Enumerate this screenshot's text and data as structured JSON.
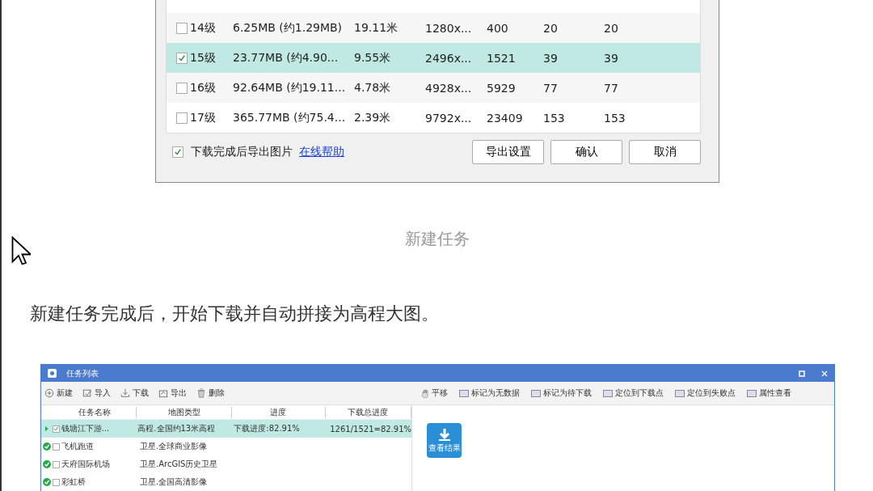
{
  "level_dialog": {
    "rows": [
      {
        "level": "14级",
        "size": "6.25MB (约1.29MB)",
        "resolution": "19.11米",
        "pixels": "1280x...",
        "column_5": "400",
        "column_6": "20",
        "column_7": "20",
        "checked": false,
        "selected": false
      },
      {
        "level": "15级",
        "size": "23.77MB (约4.90...",
        "resolution": "9.55米",
        "pixels": "2496x...",
        "column_5": "1521",
        "column_6": "39",
        "column_7": "39",
        "checked": true,
        "selected": true
      },
      {
        "level": "16级",
        "size": "92.64MB (约19.11...",
        "resolution": "4.78米",
        "pixels": "4928x...",
        "column_5": "5929",
        "column_6": "77",
        "column_7": "77",
        "checked": false,
        "selected": false
      },
      {
        "level": "17级",
        "size": "365.77MB (约75.4...",
        "resolution": "2.39米",
        "pixels": "9792x...",
        "column_5": "23409",
        "column_6": "153",
        "column_7": "153",
        "checked": false,
        "selected": false
      }
    ],
    "export_option": {
      "label": "下载完成后导出图片",
      "checked": true
    },
    "help_link": "在线帮助",
    "buttons": [
      "导出设置",
      "确认",
      "取消"
    ]
  },
  "caption": "新建任务",
  "paragraph": "新建任务完成后，开始下载并自动拼接为高程大图。",
  "task_window": {
    "title": "任务列表",
    "toolbar_left": [
      "新建",
      "导入",
      "下载",
      "导出",
      "删除"
    ],
    "toolbar_right": [
      "平移",
      "标记为无数据",
      "标记为待下载",
      "定位到下载点",
      "定位到失败点",
      "属性查看"
    ],
    "columns": [
      "任务名称",
      "地图类型",
      "进度",
      "下载总进度"
    ],
    "rows": [
      {
        "name": "钱塘江下游...",
        "map_type": "高程.全国约13米高程",
        "progress": "下载进度:82.91%",
        "total": "1261/1521=82.91%",
        "kind": "downloading",
        "checked": true,
        "selected": true
      },
      {
        "name": "飞机跑道",
        "map_type": "卫星.全球商业影像",
        "kind": "done",
        "checked": false,
        "selected": false
      },
      {
        "name": "天府国际机场",
        "map_type": "卫星.ArcGIS历史卫星",
        "kind": "done",
        "checked": false,
        "selected": false
      },
      {
        "name": "彩虹桥",
        "map_type": "卫星.全国高清影像",
        "kind": "done",
        "checked": false,
        "selected": false
      }
    ],
    "result_button": "查看结果"
  }
}
